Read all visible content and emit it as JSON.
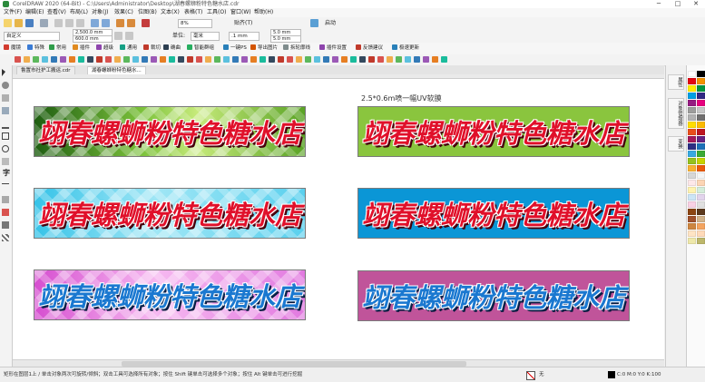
{
  "window": {
    "title": "CorelDRAW 2020 (64-Bit) - C:\\Users\\Administrator\\Desktop\\湖春螺蛳粉特色糖水店.cdr",
    "controls": [
      "─",
      "□",
      "✕"
    ]
  },
  "menu": [
    "文件(F)",
    "编辑(E)",
    "查看(V)",
    "布局(L)",
    "对象(J)",
    "效果(C)",
    "位图(B)",
    "文本(X)",
    "表格(T)",
    "工具(O)",
    "窗口(W)",
    "帮助(H)"
  ],
  "toolbar": {
    "zoom": "8%",
    "snap_label": "贴齐(T)",
    "launch_label": "启动"
  },
  "property_bar": {
    "page_preset": "自定义",
    "width": "2,500.0 mm",
    "height": "600.0 mm",
    "units_label": "单位:",
    "units_value": "毫米",
    "nudge": ".1 mm",
    "dup_x": "5.0 mm",
    "dup_y": "5.0 mm"
  },
  "plugins": [
    {
      "label": "魔镜",
      "color": "#d23b2f"
    },
    {
      "label": "特殊",
      "color": "#3a7bd5"
    },
    {
      "label": "常用",
      "color": "#2f9d4a"
    },
    {
      "label": "插件",
      "color": "#e08a1e"
    },
    {
      "label": "超级",
      "color": "#8e44ad"
    },
    {
      "label": "通用",
      "color": "#16a085"
    },
    {
      "label": "裁切",
      "color": "#c0392b"
    },
    {
      "label": "确曲",
      "color": "#2c3e50"
    },
    {
      "label": "智能群组",
      "color": "#27ae60"
    },
    {
      "label": "一键PS",
      "color": "#2980b9"
    },
    {
      "label": "导出图片",
      "color": "#d35400"
    },
    {
      "label": "拆轮廓线",
      "color": "#7f8c8d"
    },
    {
      "label": "插件设置",
      "color": "#8e44ad"
    },
    {
      "label": "反馈建议",
      "color": "#c0392b"
    },
    {
      "label": "极速更新",
      "color": "#2980b9"
    }
  ],
  "tabs": [
    {
      "label": "鲁置市社护工搬运.cdr",
      "active": false
    },
    {
      "label": "湖春螺蛳粉特色糖水...",
      "active": true
    }
  ],
  "canvas": {
    "caption": "2.5*0.6m喷一幅UV软膜",
    "banners": [
      {
        "text": "翊春螺蛳粉特色糖水店",
        "style": "green-pattern",
        "text_color": "red"
      },
      {
        "text": "翊春螺蛳粉特色糖水店",
        "style": "green-solid",
        "text_color": "red"
      },
      {
        "text": "翊春螺蛳粉特色糖水店",
        "style": "cyan-pattern",
        "text_color": "red"
      },
      {
        "text": "翊春螺蛳粉特色糖水店",
        "style": "blue-solid",
        "text_color": "red"
      },
      {
        "text": "翊春螺蛳粉特色糖水店",
        "style": "pink-pattern",
        "text_color": "blue"
      },
      {
        "text": "翊春螺蛳粉特色糖水店",
        "style": "magenta-solid",
        "text_color": "blue"
      }
    ]
  },
  "docker_tabs": [
    "属性",
    "对象管理器",
    "变换"
  ],
  "colors": {
    "green_solid": "#8ac53e",
    "blue_solid": "#0b96d6",
    "magenta_solid": "#c0549a",
    "text_red": "#e0102a",
    "text_blue": "#1a78d0"
  },
  "palette": [
    "#ffffff",
    "#000000",
    "#e30613",
    "#f39200",
    "#ffed00",
    "#009640",
    "#009fe3",
    "#312783",
    "#951b81",
    "#e6007e",
    "#9d9d9c",
    "#c6c6c6",
    "#b2b2b2",
    "#706f6f",
    "#ffdd00",
    "#fbba00",
    "#e94e1b",
    "#be1622",
    "#a3195b",
    "#662483",
    "#2d2e83",
    "#1d71b8",
    "#36a9e1",
    "#3aaa35",
    "#95c11f",
    "#c7d300",
    "#f8b133",
    "#ea5b0c",
    "#d6d6d6",
    "#f5f5f5",
    "#fde8e9",
    "#fcd5b5",
    "#fff3b0",
    "#d4edda",
    "#cce5f6",
    "#e2d4ec",
    "#f9d1e4",
    "#e0e0e0",
    "#8b4513",
    "#5c3a1e",
    "#a0522d",
    "#d2b48c",
    "#cd853f",
    "#f4a460",
    "#ffe4c4",
    "#ffdab9",
    "#eee8aa",
    "#bdb76b"
  ],
  "status": {
    "text": "矩形在图层1上 / 单击对象两次可旋转/倾斜；双击工具可选择所有对象；按住 Shift 键单击可选择多个对象；按住 Alt 键单击可进行挖掘",
    "fill_none": "无",
    "coords": "C:0 M:0 Y:0 K:100"
  }
}
